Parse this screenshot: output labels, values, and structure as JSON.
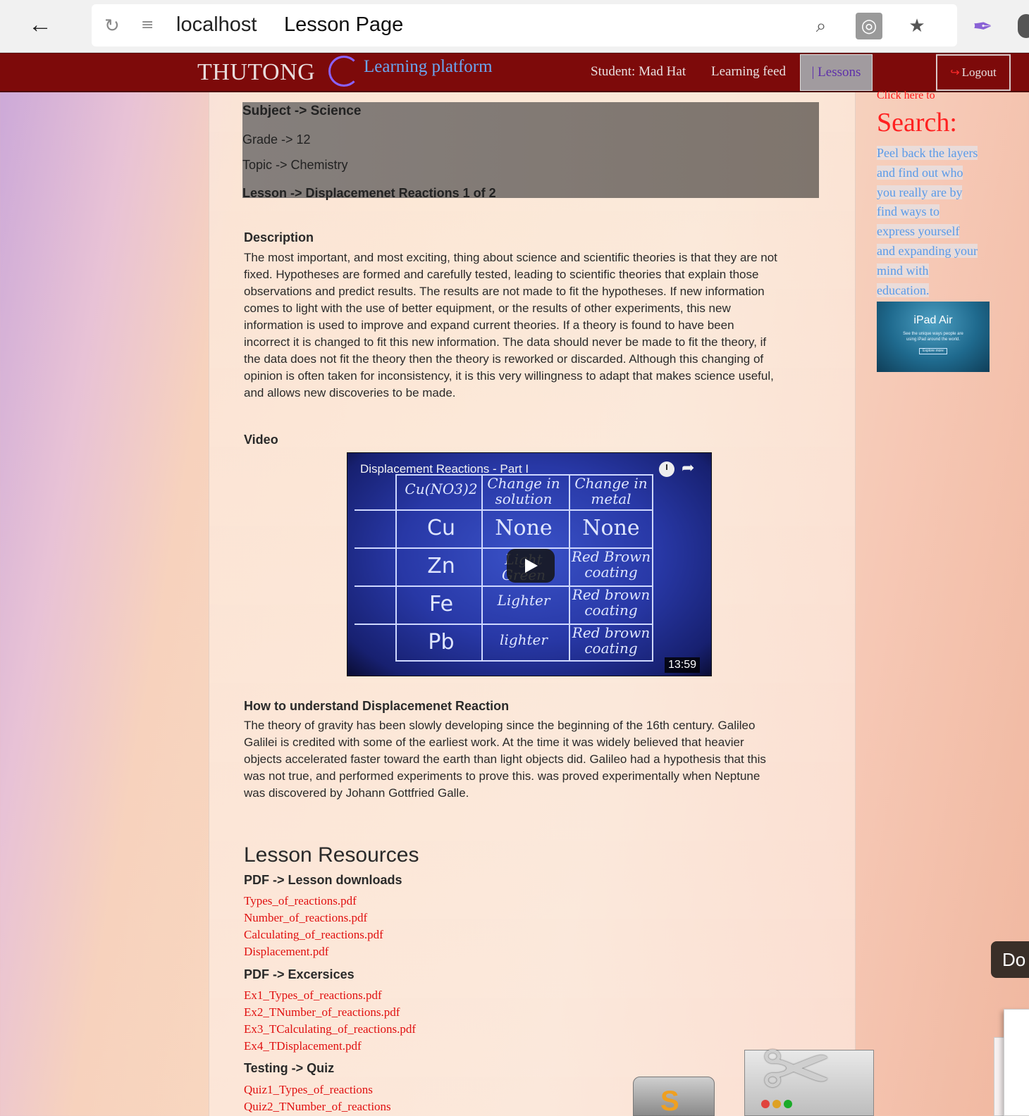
{
  "browser": {
    "back_icon": "back-arrow-icon",
    "reload_icon": "reload-icon",
    "reader_icon": "reader-view-icon",
    "host": "localhost",
    "page_title": "Lesson Page",
    "icons": [
      "search-page-icon",
      "globe-icon",
      "bookmark-star-icon",
      "feather-icon"
    ]
  },
  "navbar": {
    "brand": "THUTONG",
    "brand_sub": "Learning platform",
    "student": "Student: Mad Hat",
    "feed": "Learning feed",
    "lessons": "| Lessons",
    "logout": "Logout"
  },
  "meta": {
    "subject": "Subject -> Science",
    "grade": "Grade -> 12",
    "topic": "Topic -> Chemistry",
    "lesson": "Lesson -> Displacemenet Reactions 1 of 2"
  },
  "description": {
    "heading": "Description",
    "lines": [
      "The most important, and most exciting, thing about science and scientific theories is that they are not",
      "fixed. Hypotheses are formed and carefully tested, leading to scientific theories that explain those",
      "observations and predict results. The results are not made to fit the hypotheses. If new information",
      "comes to light with the use of better equipment, or the results of other experiments, this new",
      "information is used to improve and expand current theories. If a theory is found to have been",
      "incorrect it is changed to fit this new information. The data should never be made to fit the theory, if",
      "the data does not fit the theory then the theory is reworked or discarded. Although this changing of",
      "opinion is often taken for inconsistency, it is this very willingness to adapt that makes science useful,",
      "and allows new discoveries to be made."
    ]
  },
  "video": {
    "heading": "Video",
    "title": "Displacement Reactions - Part I",
    "duration": "13:59",
    "board": {
      "header": [
        "Cu(NO3)2",
        "Change in solution",
        "Change in metal"
      ],
      "rows": [
        [
          "Cu",
          "None",
          "None"
        ],
        [
          "Zn",
          "Light Green",
          "Red Brown coating"
        ],
        [
          "Fe",
          "Lighter",
          "Red brown coating"
        ],
        [
          "Pb",
          "lighter",
          "Red brown coating"
        ]
      ]
    }
  },
  "understand": {
    "heading": "How to understand Displacemenet Reaction",
    "lines": [
      "The theory of gravity has been slowly developing since the beginning of the 16th century. Galileo",
      "Galilei is credited with some of the earliest work. At the time it was widely believed that heavier",
      "objects accelerated faster toward the earth than light objects did. Galileo had a hypothesis that this",
      "was not true, and performed experiments to prove this. was proved experimentally when Neptune",
      "was discovered by Johann Gottfried Galle."
    ]
  },
  "resources": {
    "heading": "Lesson Resources",
    "downloads_heading": "PDF -> Lesson downloads",
    "downloads": [
      "Types_of_reactions.pdf",
      "Number_of_reactions.pdf",
      "Calculating_of_reactions.pdf",
      "Displacement.pdf"
    ],
    "exercises_heading": "PDF -> Excersices",
    "exercises": [
      "Ex1_Types_of_reactions.pdf",
      "Ex2_TNumber_of_reactions.pdf",
      "Ex3_TCalculating_of_reactions.pdf",
      "Ex4_TDisplacement.pdf"
    ],
    "quiz_heading": "Testing -> Quiz",
    "quizzes": [
      "Quiz1_Types_of_reactions",
      "Quiz2_TNumber_of_reactions"
    ]
  },
  "sidebar": {
    "click": "Click here to",
    "search": "Search:",
    "text_lines": [
      "Peel back the layers",
      "and find out who",
      "you really are by",
      "find ways to",
      "express yourself",
      "and expanding your",
      "mind with",
      "education."
    ],
    "ad": {
      "title": " iPad Air",
      "copy": "See the unique ways people are using iPad around the world.",
      "button": "Explore more"
    }
  },
  "dock": {
    "tooltip": "Do"
  },
  "colors": {
    "navbar": "#7d0a0a",
    "link": "#e01010",
    "sidebar_text": "#5a9ae8",
    "search_heading": "#ff2020"
  }
}
